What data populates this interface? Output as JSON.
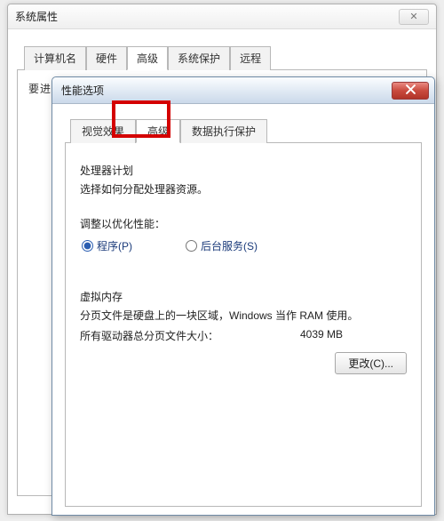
{
  "parent": {
    "title": "系统属性",
    "close_glyph": "✕",
    "tabs": {
      "computer_name": "计算机名",
      "hardware": "硬件",
      "advanced": "高级",
      "system_protection": "系统保护",
      "remote": "远程"
    },
    "body_truncated": "要进行十个条件更改，你必须作为管理员登录"
  },
  "child": {
    "title": "性能选项",
    "tabs": {
      "visual_effects": "视觉效果",
      "advanced": "高级",
      "dep": "数据执行保护"
    },
    "processor": {
      "title": "处理器计划",
      "desc": "选择如何分配处理器资源。",
      "adjust_label": "调整以优化性能：",
      "programs_label": "程序(P)",
      "background_label": "后台服务(S)"
    },
    "vm": {
      "title": "虚拟内存",
      "desc": "分页文件是硬盘上的一块区域，Windows 当作 RAM 使用。",
      "total_label": "所有驱动器总分页文件大小：",
      "total_value": "4039 MB",
      "change_button": "更改(C)..."
    }
  }
}
